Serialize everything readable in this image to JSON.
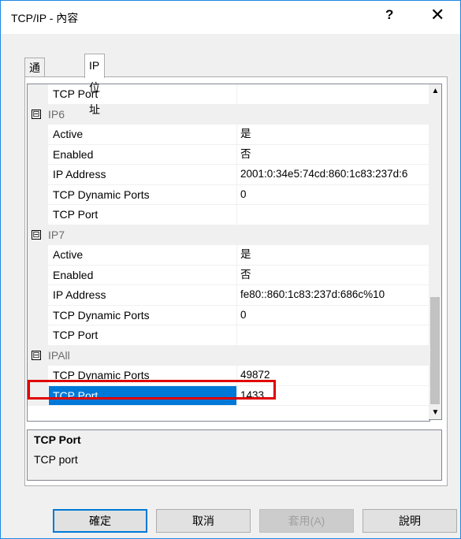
{
  "window": {
    "title": "TCP/IP - 內容",
    "help_glyph": "?",
    "close_glyph": "✕"
  },
  "tabs": [
    {
      "label": "通訊協定"
    },
    {
      "label": "IP 位址"
    }
  ],
  "grid_rows": [
    {
      "kind": "prop",
      "name": "TCP Port",
      "value": ""
    },
    {
      "kind": "cat",
      "toggle": "⊟",
      "name": "IP6"
    },
    {
      "kind": "prop",
      "name": "Active",
      "value": "是"
    },
    {
      "kind": "prop",
      "name": "Enabled",
      "value": "否"
    },
    {
      "kind": "prop",
      "name": "IP Address",
      "value": "2001:0:34e5:74cd:860:1c83:237d:6"
    },
    {
      "kind": "prop",
      "name": "TCP Dynamic Ports",
      "value": "0"
    },
    {
      "kind": "prop",
      "name": "TCP Port",
      "value": ""
    },
    {
      "kind": "cat",
      "toggle": "⊟",
      "name": "IP7"
    },
    {
      "kind": "prop",
      "name": "Active",
      "value": "是"
    },
    {
      "kind": "prop",
      "name": "Enabled",
      "value": "否"
    },
    {
      "kind": "prop",
      "name": "IP Address",
      "value": "fe80::860:1c83:237d:686c%10"
    },
    {
      "kind": "prop",
      "name": "TCP Dynamic Ports",
      "value": "0"
    },
    {
      "kind": "prop",
      "name": "TCP Port",
      "value": ""
    },
    {
      "kind": "cat",
      "toggle": "⊟",
      "name": "IPAll"
    },
    {
      "kind": "prop",
      "name": "TCP Dynamic Ports",
      "value": "49872"
    },
    {
      "kind": "prop",
      "name": "TCP Port",
      "value": "1433",
      "selected": true
    }
  ],
  "scrollbar": {
    "up_glyph": "▲",
    "down_glyph": "▼"
  },
  "description": {
    "title": "TCP Port",
    "text": "TCP port"
  },
  "buttons": {
    "ok": "確定",
    "cancel": "取消",
    "apply": "套用(A)",
    "help": "說明"
  },
  "colors": {
    "selection": "#0078d7",
    "highlight_box": "#e00000",
    "window_border": "#1e88e5"
  }
}
